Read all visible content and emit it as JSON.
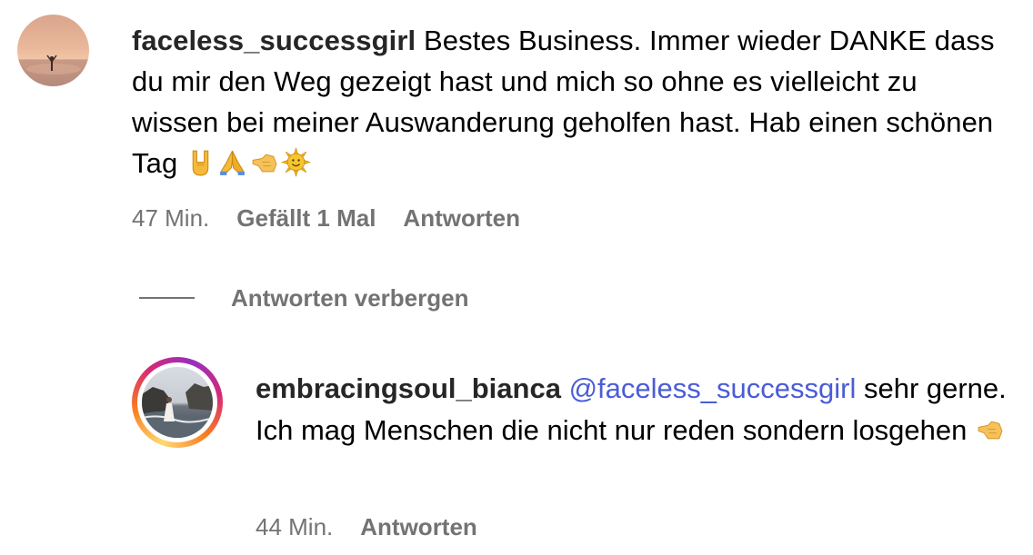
{
  "comment": {
    "username": "faceless_successgirl",
    "text_before_emojis": " Bestes Business. Immer wieder DANKE dass du mir den Weg gezeigt hast und mich so ohne es vielleicht zu wissen bei meiner Auswanderung geholfen hast. Hab einen schönen Tag ",
    "emojis": [
      "sign-of-the-horns",
      "folded-hands",
      "backhand-pointing-left",
      "sun-with-face"
    ],
    "time": "47 Min.",
    "likes": "Gefällt 1 Mal",
    "reply": "Antworten"
  },
  "hide_replies": {
    "label": "Antworten verbergen"
  },
  "reply_comment": {
    "username": "embracingsoul_bianca",
    "mention": "@faceless_successgirl",
    "text": " sehr gerne. Ich mag Menschen die nicht nur reden sondern losgehen ",
    "emojis": [
      "backhand-pointing-left"
    ],
    "time": "44 Min.",
    "reply": "Antworten"
  },
  "colors": {
    "text": "#000000",
    "username": "#262626",
    "meta": "#737373",
    "mention": "#4a5cd6"
  }
}
